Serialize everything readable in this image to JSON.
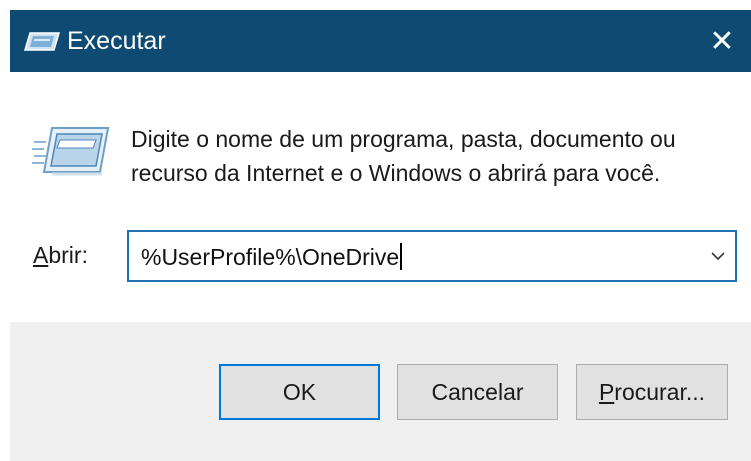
{
  "window": {
    "title": "Executar",
    "close_glyph": "✕"
  },
  "icons": {
    "title_icon": "run-dialog-icon",
    "main_icon": "run-dialog-icon",
    "dropdown": "chevron-down-icon",
    "close": "close-icon"
  },
  "content": {
    "description": "Digite o nome de um programa, pasta, documento ou recurso da Internet e o Windows o abrirá para você.",
    "open_label_mnemonic": "A",
    "open_label_rest": "brir:",
    "input_value": "%UserProfile%\\OneDrive"
  },
  "buttons": {
    "ok": "OK",
    "cancel": "Cancelar",
    "browse_mnemonic": "P",
    "browse_rest": "rocurar..."
  },
  "colors": {
    "titlebar": "#0e4a72",
    "focus_border": "#1f6fb2",
    "default_button_border": "#0078d7",
    "footer": "#f0f0f0"
  }
}
